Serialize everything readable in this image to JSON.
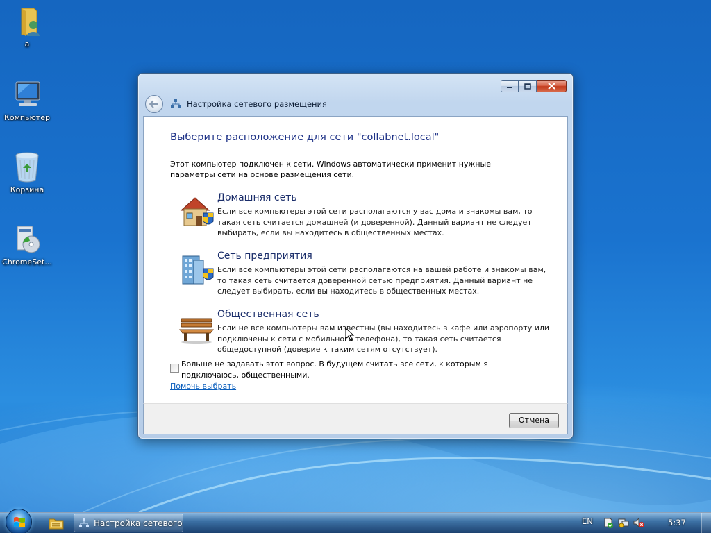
{
  "desktop": {
    "icons": [
      {
        "label": "a",
        "icon": "user-folder-icon"
      },
      {
        "label": "Компьютер",
        "icon": "computer-icon"
      },
      {
        "label": "Корзина",
        "icon": "recycle-bin-icon"
      },
      {
        "label": "ChromeSet...",
        "icon": "installer-icon"
      }
    ]
  },
  "window": {
    "title": "Настройка сетевого размещения",
    "heading": "Выберите расположение для сети \"collabnet.local\"",
    "intro": "Этот компьютер подключен к сети. Windows автоматически применит нужные параметры сети на основе размещения сети.",
    "options": [
      {
        "title": "Домашняя сеть",
        "description": "Если все компьютеры этой сети располагаются у вас дома и знакомы вам, то такая сеть считается домашней (и доверенной). Данный вариант не следует выбирать, если вы находитесь в общественных местах.",
        "icon": "home-network-icon"
      },
      {
        "title": "Сеть предприятия",
        "description": "Если все компьютеры этой сети располагаются на вашей работе и знакомы вам, то такая сеть считается доверенной сетью предприятия. Данный вариант не следует выбирать, если вы находитесь в общественных местах.",
        "icon": "work-network-icon"
      },
      {
        "title": "Общественная сеть",
        "description": "Если не все компьютеры вам известны (вы находитесь в кафе или аэропорту или подключены к сети с мобильного телефона), то такая сеть считается общедоступной (доверие к таким сетям отсутствует).",
        "icon": "public-network-icon"
      }
    ],
    "checkbox_label": "Больше не задавать этот вопрос. В будущем считать все сети, к которым я подключаюсь, общественными.",
    "checkbox_checked": false,
    "help_link": "Помочь выбрать",
    "cancel_label": "Отмена"
  },
  "taskbar": {
    "task_label": "Настройка сетевого...",
    "language": "EN",
    "clock": "5:37",
    "tray_icons": [
      "action-center-icon",
      "network-icon",
      "volume-muted-icon"
    ]
  }
}
